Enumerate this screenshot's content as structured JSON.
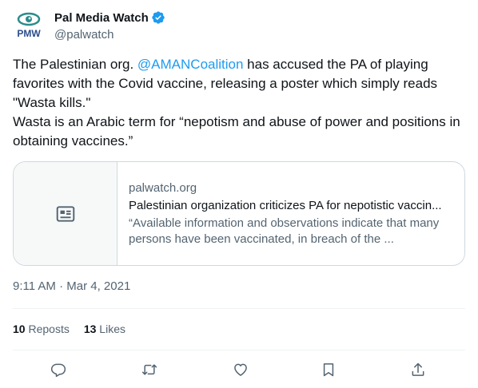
{
  "author": {
    "name": "Pal Media Watch",
    "handle": "@palwatch",
    "verified": true,
    "avatar_text": "PMW"
  },
  "tweet": {
    "text_before_mention": "The Palestinian org. ",
    "mention": "@AMANCoalition",
    "text_after_mention": " has accused the PA of playing favorites with the Covid vaccine, releasing a poster which simply reads \"Wasta kills.\"\nWasta is an Arabic term for “nepotism and abuse of power and positions in obtaining vaccines.”"
  },
  "card": {
    "domain": "palwatch.org",
    "title": "Palestinian organization criticizes PA for nepotistic vaccin...",
    "description": "“Available information and observations indicate that many persons have been vaccinated, in breach of the ..."
  },
  "timestamp": "9:11 AM · Mar 4, 2021",
  "stats": {
    "reposts_count": "10",
    "reposts_label": "Reposts",
    "likes_count": "13",
    "likes_label": "Likes"
  },
  "actions": [
    "reply-icon",
    "repost-icon",
    "like-icon",
    "bookmark-icon",
    "share-icon"
  ],
  "colors": {
    "link": "#1d9bf0",
    "text": "#0f1419",
    "secondary": "#536471",
    "border": "#cfd9de",
    "avatar_teal": "#2a8c8c"
  }
}
